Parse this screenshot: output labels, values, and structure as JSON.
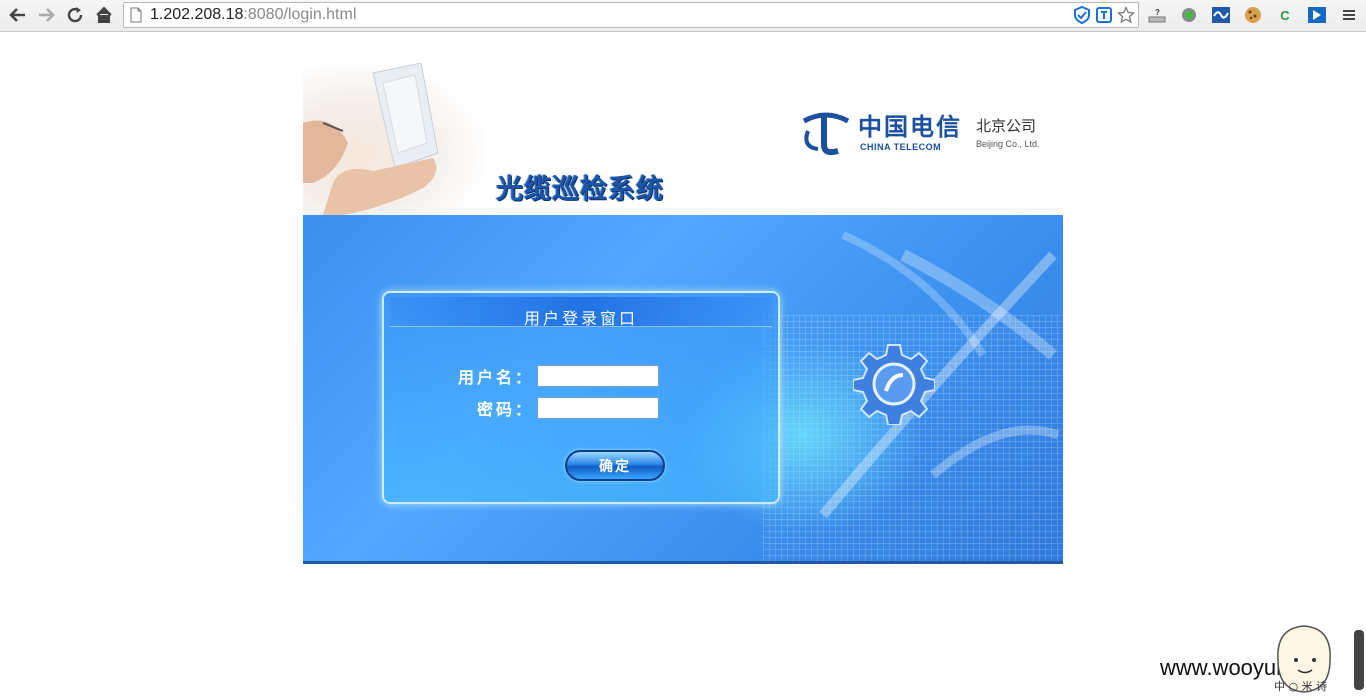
{
  "browser": {
    "url_host": "1.202.208.18",
    "url_rest": ":8080/login.html",
    "extension_c_label": "C"
  },
  "page": {
    "system_title": "光缆巡检系统",
    "logo": {
      "name_cn": "中国电信",
      "name_en": "CHINA TELECOM",
      "branch_cn": "北京公司",
      "branch_en": "Beijing Co., Ltd."
    },
    "login": {
      "window_title": "用户登录窗口",
      "username_label": "用户名：",
      "password_label": "密码：",
      "submit_label": "确定",
      "username_value": "",
      "password_value": ""
    }
  },
  "watermark": {
    "text": "www.wooyun.org",
    "mascot_text": "中 ○ 米 诗"
  },
  "colors": {
    "banner_blue": "#3d92f0",
    "title_blue": "#1d56a8",
    "telecom_blue": "#1b4fa0"
  }
}
